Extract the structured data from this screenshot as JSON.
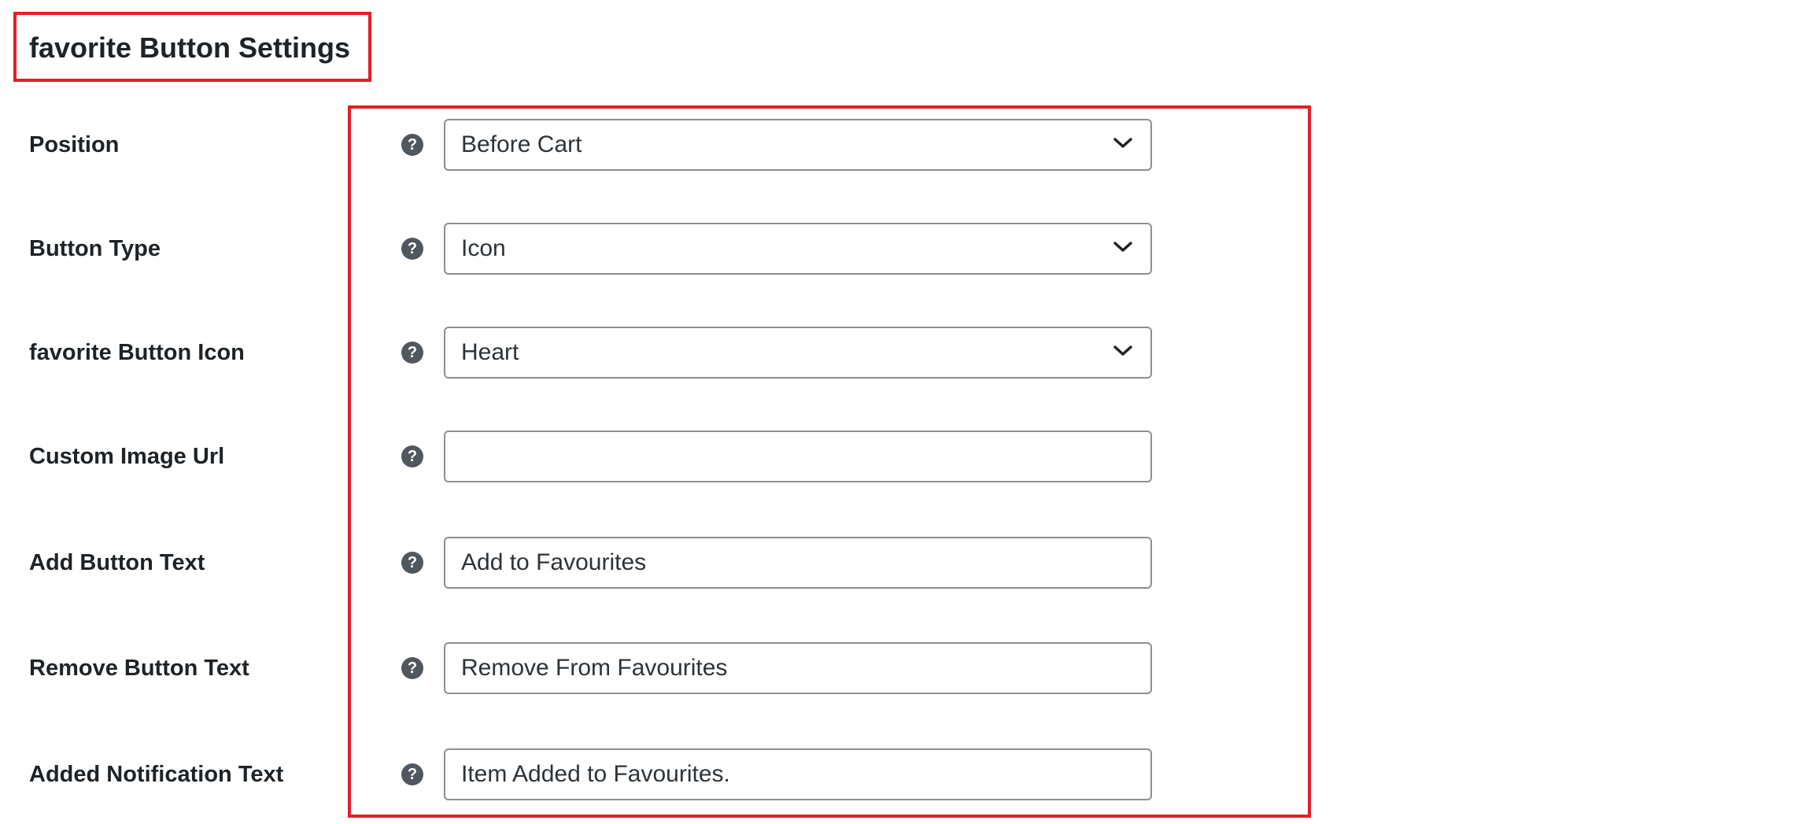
{
  "section": {
    "title": "favorite Button Settings"
  },
  "icons": {
    "help": "help-icon",
    "dropdown": "chevron-down-icon"
  },
  "fields": {
    "position": {
      "label": "Position",
      "help_glyph": "?",
      "value": "Before Cart"
    },
    "button_type": {
      "label": "Button Type",
      "help_glyph": "?",
      "value": "Icon"
    },
    "button_icon": {
      "label": "favorite Button Icon",
      "help_glyph": "?",
      "value": "Heart"
    },
    "custom_image_url": {
      "label": "Custom Image Url",
      "help_glyph": "?",
      "value": ""
    },
    "add_button_text": {
      "label": "Add Button Text",
      "help_glyph": "?",
      "value": "Add to Favourites"
    },
    "remove_button_text": {
      "label": "Remove Button Text",
      "help_glyph": "?",
      "value": "Remove From Favourites"
    },
    "added_notification_text": {
      "label": "Added Notification Text",
      "help_glyph": "?",
      "value": "Item Added to Favourites."
    }
  },
  "colors": {
    "highlight_border": "#e02027",
    "field_border": "#8c8f94",
    "help_icon_bg": "#50575e",
    "label_text": "#1d2327"
  }
}
